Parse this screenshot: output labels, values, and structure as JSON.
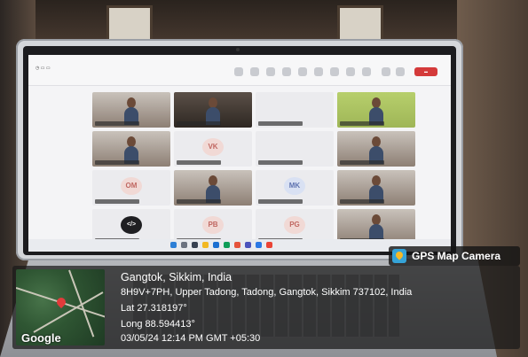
{
  "scene": {
    "description_colors": {
      "accent": "#35a3d8",
      "leave": "#d43a3a",
      "pin": "#e23b3b"
    }
  },
  "meeting": {
    "participants": [
      {
        "initials": "",
        "kind": "photo"
      },
      {
        "initials": "",
        "kind": "dark"
      },
      {
        "initials": "",
        "kind": "plain"
      },
      {
        "initials": "",
        "kind": "green"
      },
      {
        "initials": "",
        "kind": "photo"
      },
      {
        "initials": "VK",
        "kind": "avatar"
      },
      {
        "initials": "",
        "kind": "plain"
      },
      {
        "initials": "",
        "kind": "photo"
      },
      {
        "initials": "OM",
        "kind": "avatar"
      },
      {
        "initials": "",
        "kind": "photo"
      },
      {
        "initials": "MK",
        "kind": "avatar-blue"
      },
      {
        "initials": "",
        "kind": "photo"
      },
      {
        "initials": "</>",
        "kind": "avatar-dark"
      },
      {
        "initials": "PB",
        "kind": "avatar"
      },
      {
        "initials": "PG",
        "kind": "avatar"
      },
      {
        "initials": "",
        "kind": "photo"
      }
    ]
  },
  "gps": {
    "app_label": "GPS Map Camera",
    "place": "Gangtok, Sikkim, India",
    "address": "8H9V+7PH, Upper Tadong, Tadong, Gangtok, Sikkim 737102, India",
    "lat": "Lat 27.318197°",
    "long": "Long 88.594413°",
    "datetime": "03/05/24 12:14 PM GMT +05:30",
    "map_brand": "Google"
  }
}
